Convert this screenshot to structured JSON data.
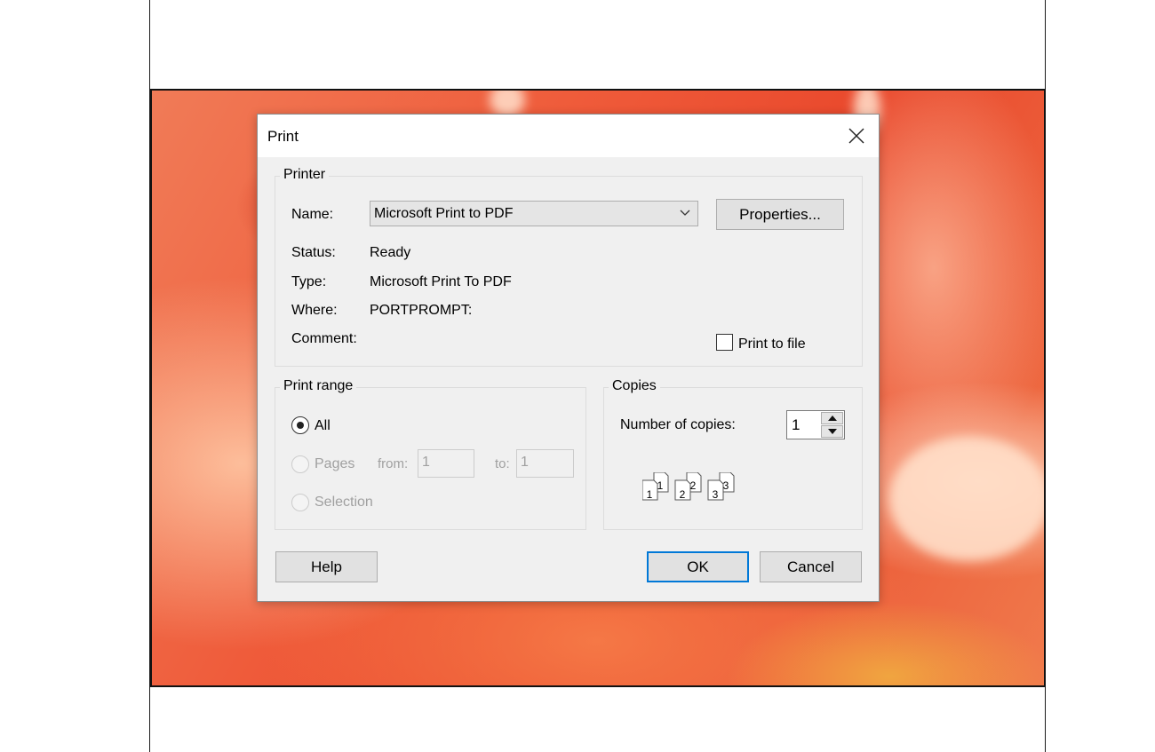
{
  "dialog": {
    "title": "Print",
    "close_icon": "close-icon"
  },
  "printer": {
    "group_label": "Printer",
    "name_label": "Name:",
    "name_value": "Microsoft Print to PDF",
    "properties_button": "Properties...",
    "status_label": "Status:",
    "status_value": "Ready",
    "type_label": "Type:",
    "type_value": "Microsoft Print To PDF",
    "where_label": "Where:",
    "where_value": "PORTPROMPT:",
    "comment_label": "Comment:",
    "print_to_file_label": "Print to file",
    "print_to_file_checked": false
  },
  "print_range": {
    "group_label": "Print range",
    "all_label": "All",
    "pages_label": "Pages",
    "from_label": "from:",
    "from_value": "1",
    "to_label": "to:",
    "to_value": "1",
    "selection_label": "Selection",
    "selected": "All"
  },
  "copies": {
    "group_label": "Copies",
    "number_label": "Number of copies:",
    "number_value": "1",
    "collate_pages": [
      "1",
      "1",
      "2",
      "2",
      "3",
      "3"
    ]
  },
  "buttons": {
    "help": "Help",
    "ok": "OK",
    "cancel": "Cancel"
  },
  "colors": {
    "dialog_bg": "#f0f0f0",
    "default_button_border": "#0078d7",
    "wallpaper_main": "#ef5b3a"
  }
}
